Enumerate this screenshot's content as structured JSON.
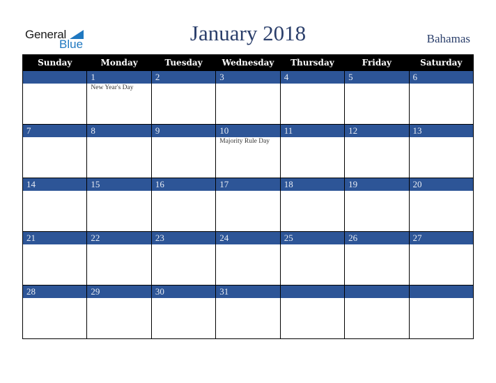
{
  "logo": {
    "word1": "General",
    "word2": "Blue",
    "accent_color": "#1f78c0"
  },
  "header": {
    "title": "January 2018",
    "country": "Bahamas"
  },
  "colors": {
    "header_bg": "#000000",
    "band_bg": "#2d5597",
    "title_color": "#2b3f6b"
  },
  "weekdays": [
    "Sunday",
    "Monday",
    "Tuesday",
    "Wednesday",
    "Thursday",
    "Friday",
    "Saturday"
  ],
  "weeks": [
    {
      "days": [
        "",
        "1",
        "2",
        "3",
        "4",
        "5",
        "6"
      ],
      "events": [
        "",
        "New Year's Day",
        "",
        "",
        "",
        "",
        ""
      ]
    },
    {
      "days": [
        "7",
        "8",
        "9",
        "10",
        "11",
        "12",
        "13"
      ],
      "events": [
        "",
        "",
        "",
        "Majority Rule Day",
        "",
        "",
        ""
      ]
    },
    {
      "days": [
        "14",
        "15",
        "16",
        "17",
        "18",
        "19",
        "20"
      ],
      "events": [
        "",
        "",
        "",
        "",
        "",
        "",
        ""
      ]
    },
    {
      "days": [
        "21",
        "22",
        "23",
        "24",
        "25",
        "26",
        "27"
      ],
      "events": [
        "",
        "",
        "",
        "",
        "",
        "",
        ""
      ]
    },
    {
      "days": [
        "28",
        "29",
        "30",
        "31",
        "",
        "",
        ""
      ],
      "events": [
        "",
        "",
        "",
        "",
        "",
        "",
        ""
      ]
    }
  ]
}
